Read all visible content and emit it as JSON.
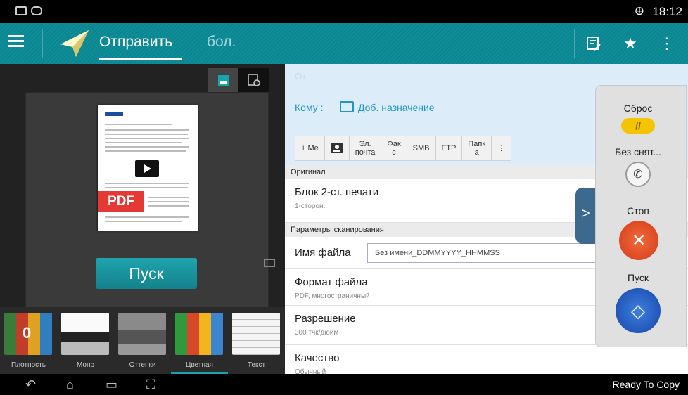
{
  "status_bar": {
    "time": "18:12"
  },
  "app_bar": {
    "title": "Отправить",
    "more_tab": "бол."
  },
  "preview": {
    "pdf_badge": "PDF",
    "start_label": "Пуск"
  },
  "color_modes": [
    {
      "label": "Плотность",
      "value": "0"
    },
    {
      "label": "Моно"
    },
    {
      "label": "Оттенки"
    },
    {
      "label": "Цветная"
    },
    {
      "label": "Текст"
    }
  ],
  "form": {
    "from_label": "От",
    "to_label": "Кому :",
    "add_destination": "Доб. назначение",
    "chips": [
      "+ Me",
      "",
      "Эл.\nпочта",
      "Фак\nс",
      "SMB",
      "FTP",
      "Папк\nа",
      "⋮"
    ],
    "original_section": "Оригинал",
    "duplex_title": "Блок 2-ст. печати",
    "duplex_value": "1-сторон.",
    "scan_section": "Параметры сканирования",
    "filename_label": "Имя файла",
    "filename_value": "Без имени_DDMMYYYY_HHMMSS",
    "format_title": "Формат файла",
    "format_value": "PDF, многостраничный",
    "resolution_title": "Разрешение",
    "resolution_value": "300 тчк/дюйм",
    "quality_title": "Качество",
    "quality_value": "Обычный"
  },
  "control_panel": {
    "reset_label": "Сброс",
    "nocopy_label": "Без снят...",
    "stop_label": "Стоп",
    "start_label": "Пуск"
  },
  "nav_bar": {
    "status": "Ready To Copy"
  },
  "colors": {
    "accent": "#17a4ae",
    "stop": "#e53935",
    "start": "#1e5fc9",
    "reset": "#f5c400"
  }
}
